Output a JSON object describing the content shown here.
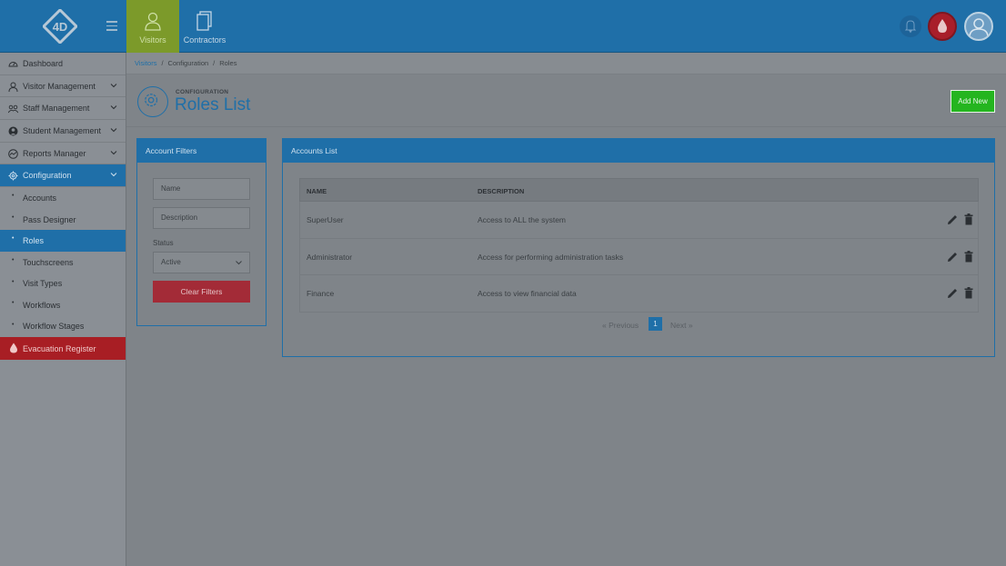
{
  "colors": {
    "accent": "#1f6fa8",
    "success": "#24b51f",
    "danger": "#a81e24"
  },
  "header": {
    "tabs": [
      {
        "label": "Visitors",
        "icon": "user-icon",
        "active": true
      },
      {
        "label": "Contractors",
        "icon": "document-icon",
        "active": false
      }
    ]
  },
  "sidebar": {
    "items": [
      {
        "label": "Dashboard",
        "icon": "dashboard-icon"
      },
      {
        "label": "Visitor Management",
        "icon": "user-icon"
      },
      {
        "label": "Staff Management",
        "icon": "group-icon"
      },
      {
        "label": "Student Management",
        "icon": "student-icon"
      },
      {
        "label": "Reports Manager",
        "icon": "reports-icon"
      },
      {
        "label": "Configuration",
        "icon": "gear-icon"
      }
    ],
    "subitems": [
      "Accounts",
      "Pass Designer",
      "Roles",
      "Touchscreens",
      "Visit Types",
      "Workflows",
      "Workflow Stages"
    ],
    "active_subitem": "Roles",
    "evacuation": "Evacuation Register"
  },
  "breadcrumb": {
    "items": [
      "Visitors",
      "Configuration",
      "Roles"
    ]
  },
  "page": {
    "kicker": "CONFIGURATION",
    "title": "Roles List",
    "add_label": "Add New"
  },
  "filters": {
    "title": "Account Filters",
    "name_placeholder": "Name",
    "description_placeholder": "Description",
    "status_label": "Status",
    "status_value": "Active",
    "clear_label": "Clear Filters"
  },
  "accounts": {
    "title": "Accounts List",
    "columns": [
      "NAME",
      "DESCRIPTION"
    ],
    "rows": [
      {
        "name": "SuperUser",
        "description": "Access to ALL the system"
      },
      {
        "name": "Administrator",
        "description": "Access for performing administration tasks"
      },
      {
        "name": "Finance",
        "description": "Access to view financial data"
      }
    ],
    "pagination": {
      "prev": "«  Previous",
      "current": "1",
      "next": "Next  »"
    }
  }
}
